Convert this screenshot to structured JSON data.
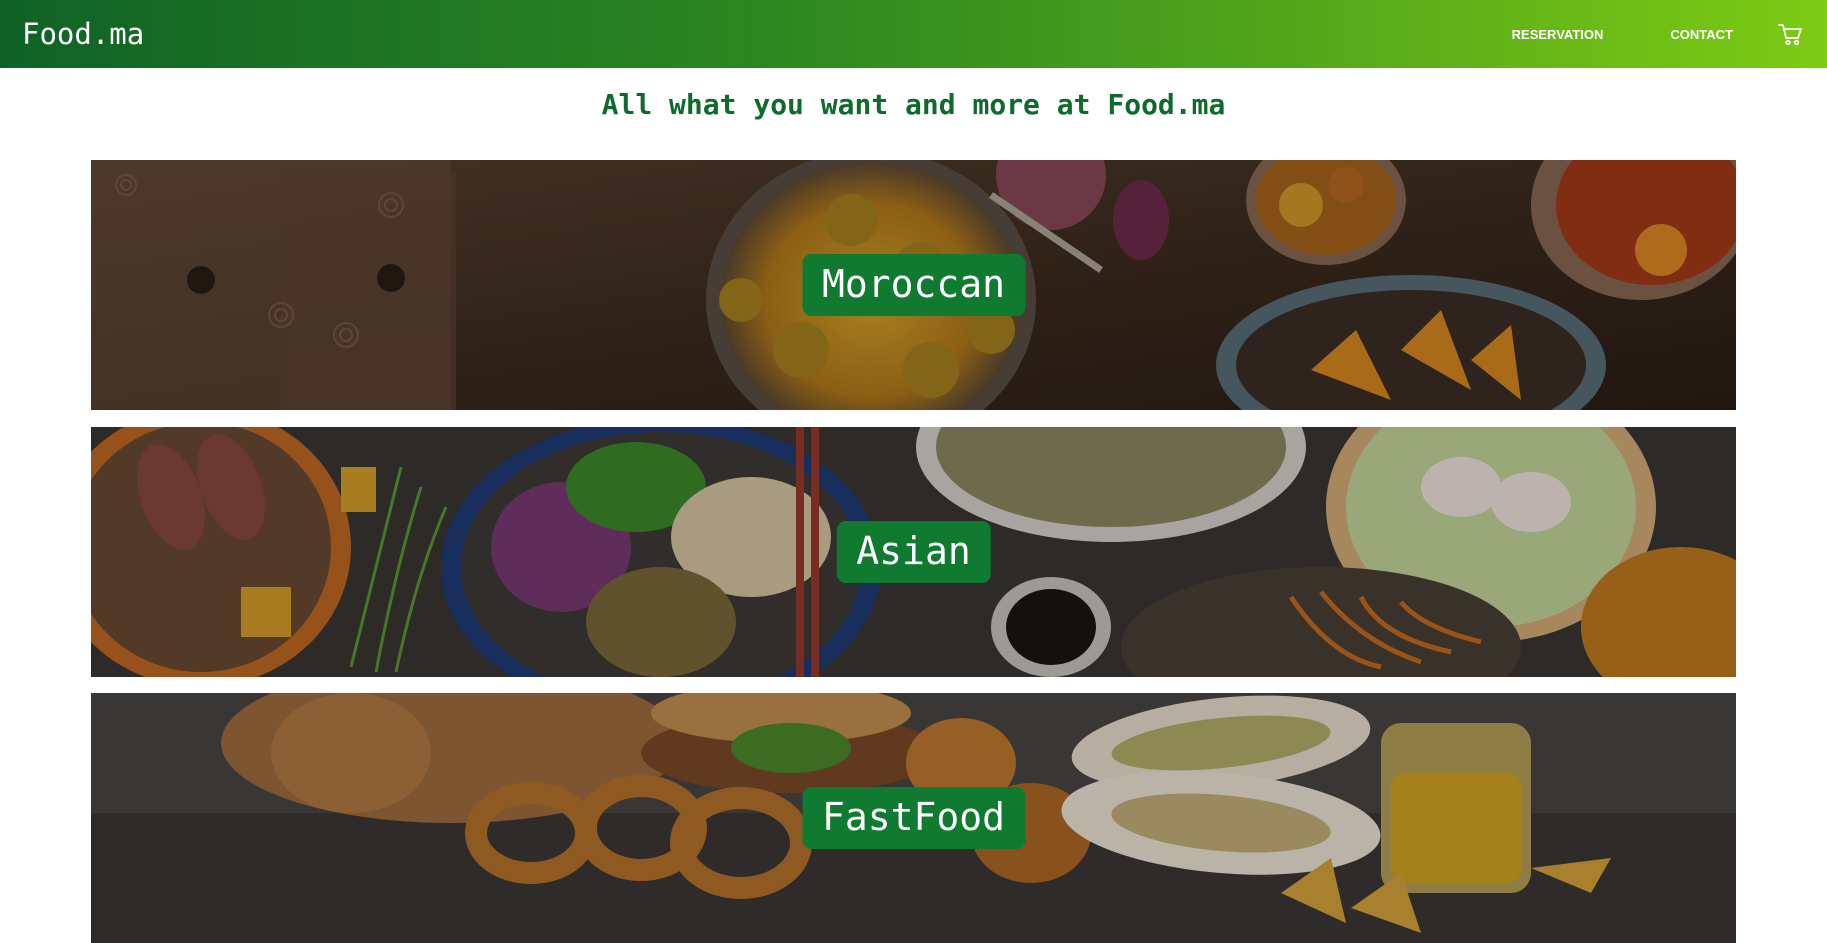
{
  "header": {
    "brand": "Food.ma",
    "nav": {
      "reservation": "RESERVATION",
      "contact": "CONTACT"
    },
    "cart_icon": "cart-icon"
  },
  "main": {
    "tagline": "All what you want and more at Food.ma",
    "categories": [
      {
        "label": "Moroccan",
        "image": "moroccan-dishes-photo"
      },
      {
        "label": "Asian",
        "image": "asian-dishes-photo"
      },
      {
        "label": "FastFood",
        "image": "fastfood-photo"
      }
    ]
  },
  "colors": {
    "nav_gradient_start": "#0f6226",
    "nav_gradient_end": "#7ecb14",
    "tagline": "#0f6b2c",
    "label_bg": "#0f7a30"
  }
}
